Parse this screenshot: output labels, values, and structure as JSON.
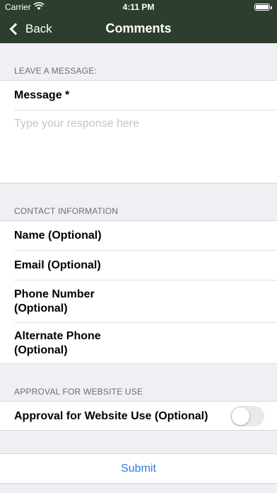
{
  "status_bar": {
    "carrier": "Carrier",
    "time": "4:11 PM",
    "wifi_icon": "wifi-icon",
    "battery_icon": "battery-icon"
  },
  "nav": {
    "back_label": "Back",
    "title": "Comments",
    "back_icon": "chevron-left-icon",
    "bar_color": "#2e3e2e"
  },
  "leave_message": {
    "header": "LEAVE A MESSAGE:",
    "message_label": "Message *",
    "message_placeholder": "Type your response here"
  },
  "contact": {
    "header": "CONTACT INFORMATION",
    "name_label": "Name (Optional)",
    "email_label": "Email (Optional)",
    "phone_label_line1": "Phone Number",
    "phone_label_line2": "(Optional)",
    "alt_phone_label_line1": "Alternate Phone",
    "alt_phone_label_line2": "(Optional)"
  },
  "approval": {
    "header": "APPROVAL FOR WEBSITE USE",
    "toggle_label": "Approval for Website Use (Optional)",
    "toggle_on": false
  },
  "submit_label": "Submit",
  "colors": {
    "accent": "#2f7ee0",
    "background": "#efeff4"
  }
}
